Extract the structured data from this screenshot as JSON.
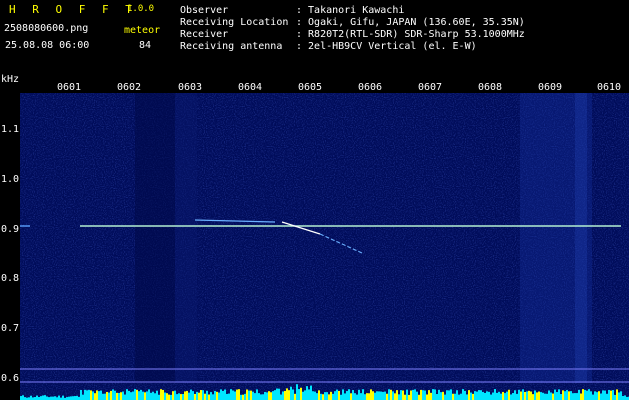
{
  "header": {
    "logo": "H R O F F T",
    "version": "1.0.0",
    "filename": "2508080600.png",
    "datetime": "25.08.08 06:00",
    "detection_type": "meteor",
    "detection_count": "84"
  },
  "info": [
    {
      "key": "Observer",
      "value": ": Takanori Kawachi"
    },
    {
      "key": "Receiving Location",
      "value": ": Ogaki, Gifu, JAPAN (136.60E, 35.35N)"
    },
    {
      "key": "Receiver",
      "value": ": R820T2(RTL-SDR) SDR-Sharp 53.1000MHz"
    },
    {
      "key": "Receiving antenna",
      "value": ": 2el-HB9CV Vertical (el. E-W)"
    }
  ],
  "axes": {
    "y_unit": "kHz",
    "y_ticks": [
      "1.1",
      "1.0",
      "0.9",
      "0.8",
      "0.7",
      "0.6"
    ],
    "x_ticks": [
      "0601",
      "0602",
      "0603",
      "0604",
      "0605",
      "0606",
      "0607",
      "0608",
      "0609",
      "0610"
    ]
  },
  "colors": {
    "background": "#000000",
    "spectrogram": "#000c5a",
    "carrier": "#b4f0d2",
    "text": "#ffffff",
    "accent": "#ffff00",
    "level_bar": "#00e6ff"
  }
}
